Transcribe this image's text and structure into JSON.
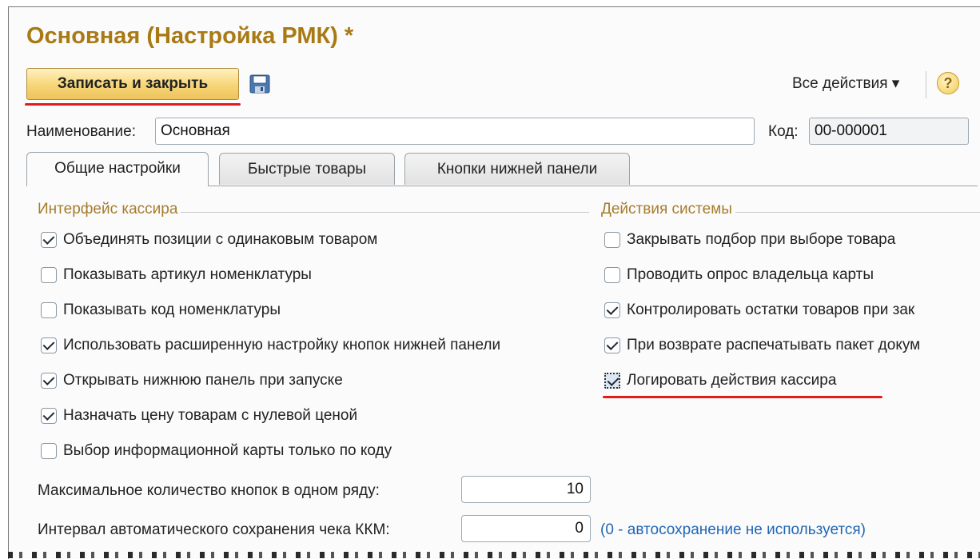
{
  "form": {
    "title": "Основная (Настройка РМК) *",
    "write_close_label": "Записать и закрыть",
    "all_actions_label": "Все действия ▾",
    "help_label": "?"
  },
  "fields": {
    "name_label": "Наименование:",
    "name_value": "Основная",
    "code_label": "Код:",
    "code_value": "00-000001"
  },
  "tabs": [
    {
      "label": "Общие настройки",
      "active": true
    },
    {
      "label": "Быстрые товары",
      "active": false
    },
    {
      "label": "Кнопки нижней панели",
      "active": false
    }
  ],
  "cashier_interface": {
    "title": "Интерфейс кассира",
    "items": [
      {
        "label": "Объединять позиции с одинаковым товаром",
        "checked": true
      },
      {
        "label": "Показывать артикул номенклатуры",
        "checked": false
      },
      {
        "label": "Показывать код номенклатуры",
        "checked": false
      },
      {
        "label": "Использовать расширенную настройку кнопок нижней панели",
        "checked": true
      },
      {
        "label": "Открывать нижнюю панель при запуске",
        "checked": true
      },
      {
        "label": "Назначать цену товарам с нулевой ценой",
        "checked": true
      },
      {
        "label": "Выбор информационной карты только по коду",
        "checked": false
      }
    ]
  },
  "system_actions": {
    "title": "Действия системы",
    "items": [
      {
        "label": "Закрывать подбор при выборе товара",
        "checked": false
      },
      {
        "label": "Проводить опрос владельца карты",
        "checked": false
      },
      {
        "label": "Контролировать остатки товаров при зак",
        "checked": true
      },
      {
        "label": "При возврате распечатывать пакет докум",
        "checked": true
      },
      {
        "label": "Логировать действия кассира",
        "checked": true,
        "focused": true
      }
    ]
  },
  "numeric": {
    "max_buttons_label": "Максимальное количество кнопок в одном ряду:",
    "max_buttons_value": "10",
    "autosave_label": "Интервал автоматического сохранения чека ККМ:",
    "autosave_value": "0",
    "autosave_hint": "(0 - автосохранение не используется)"
  },
  "colors": {
    "title": "#a97a14",
    "group_title": "#a67d2c",
    "highlight_underline": "#e21b1b",
    "hint": "#1f66b5"
  }
}
